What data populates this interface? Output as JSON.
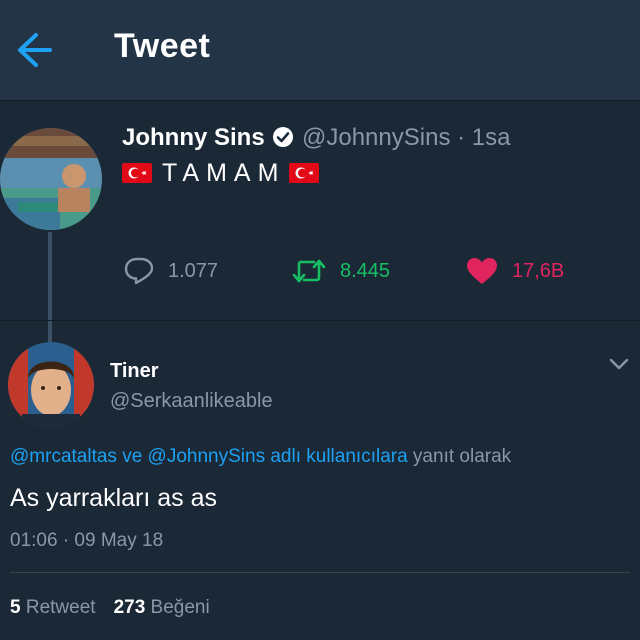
{
  "header": {
    "title": "Tweet"
  },
  "parent_tweet": {
    "name": "Johnny Sins",
    "handle_time": "@JohnnySins · 1sa",
    "text": "TAMAM",
    "replies": "1.077",
    "retweets": "8.445",
    "likes": "17,6B"
  },
  "tweet": {
    "name": "Tiner",
    "handle": "@Serkaanlikeable",
    "reply_to_user1": "@mrcataltas",
    "reply_to_joiner": " ve ",
    "reply_to_user2": "@JohnnySins",
    "reply_to_suffix": " adlı kullanıcılara",
    "reply_to_tail": " yanıt olarak",
    "text": "As yarrakları as as",
    "timestamp": "01:06 · 09 May 18",
    "retweet_count": "5",
    "retweet_label": " Retweet",
    "like_count": "273",
    "like_label": " Beğeni"
  },
  "colors": {
    "background": "#1b2836",
    "header": "#243447",
    "link": "#1da1f2",
    "retweet": "#17bf63",
    "like": "#e0245e",
    "muted": "#8899a6"
  },
  "icons": [
    "back-arrow-icon",
    "verified-icon",
    "turkish-flag-icon",
    "reply-icon",
    "retweet-icon",
    "heart-icon",
    "chevron-down-icon"
  ]
}
